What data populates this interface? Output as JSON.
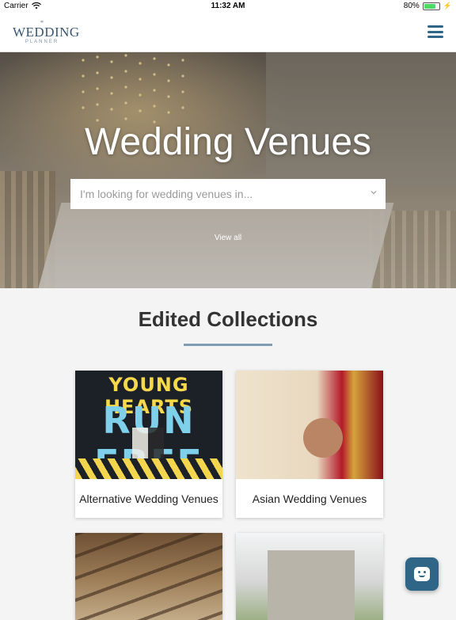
{
  "status_bar": {
    "carrier": "Carrier",
    "time": "11:32 AM",
    "battery": "80%",
    "battery_level": 0.8
  },
  "header": {
    "logo_main": "WEDDING",
    "logo_sub": "PLANNER",
    "menu_icon": "hamburger-icon"
  },
  "hero": {
    "title": "Wedding Venues",
    "select_placeholder": "I'm looking for wedding venues in...",
    "view_all": "View all"
  },
  "collections": {
    "title": "Edited Collections",
    "accent_color": "#7f9db2",
    "items": [
      {
        "label": "Alternative Wedding Venues",
        "image_text_1": "YOUNG HEARTS",
        "image_text_2": "RUN FREE"
      },
      {
        "label": "Asian Wedding Venues"
      },
      {
        "label": ""
      },
      {
        "label": ""
      }
    ]
  },
  "chat": {
    "icon": "chat-smile-icon",
    "color": "#2f6687"
  }
}
